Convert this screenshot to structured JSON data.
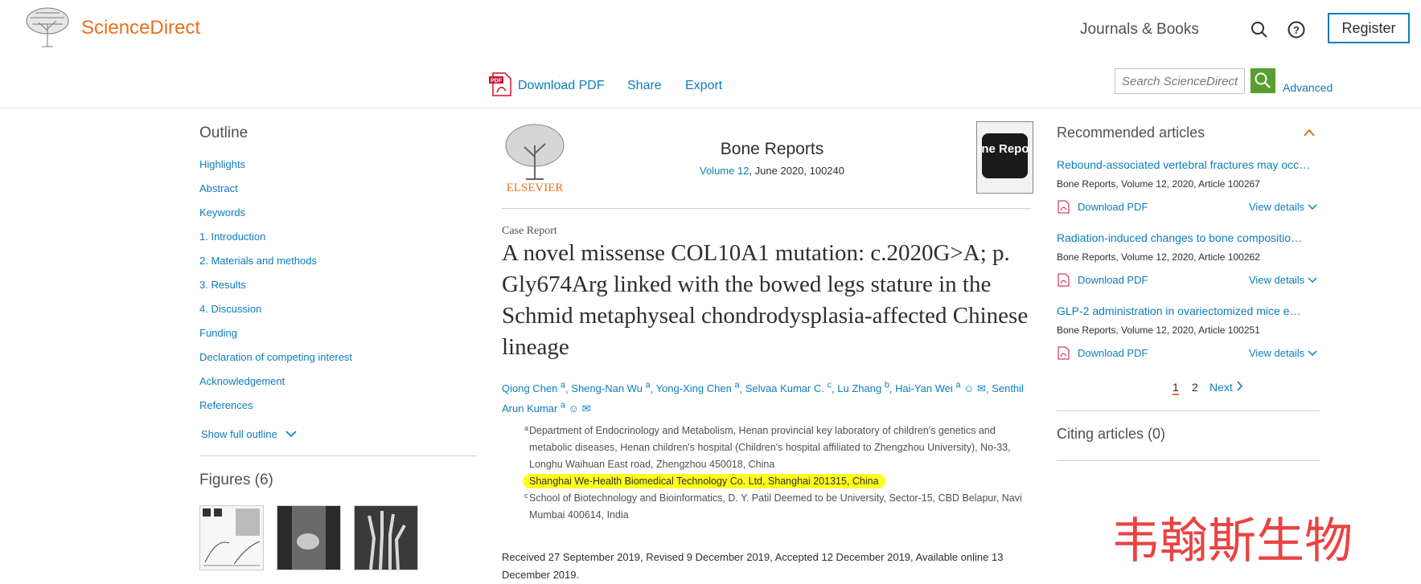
{
  "header": {
    "brand": "ScienceDirect",
    "journals_books": "Journals & Books",
    "register": "Register"
  },
  "toolbar": {
    "download_pdf": "Download PDF",
    "share": "Share",
    "export": "Export",
    "search_placeholder": "Search ScienceDirect",
    "advanced": "Advanced"
  },
  "outline": {
    "title": "Outline",
    "items": [
      "Highlights",
      "Abstract",
      "Keywords",
      "1. Introduction",
      "2. Materials and methods",
      "3. Results",
      "4. Discussion",
      "Funding",
      "Declaration of competing interest",
      "Acknowledgement",
      "References"
    ],
    "show_full": "Show full outline",
    "figures_title": "Figures (6)"
  },
  "article": {
    "publisher": "ELSEVIER",
    "journal": "Bone Reports",
    "volume_link": "Volume 12",
    "issue_info": ", June 2020, 100240",
    "cover_text": "Bone Reports",
    "type": "Case Report",
    "title": "A novel missense COL10A1 mutation: c.2020G>A; p. Gly674Arg linked with the bowed legs stature in the Schmid metaphyseal chondrodysplasia-affected Chinese lineage",
    "authors": [
      {
        "name": "Qiong Chen",
        "sup": "a"
      },
      {
        "name": "Sheng-Nan Wu",
        "sup": "a"
      },
      {
        "name": "Yong-Xing Chen",
        "sup": "a"
      },
      {
        "name": "Selvaa Kumar C.",
        "sup": "c"
      },
      {
        "name": "Lu Zhang",
        "sup": "b"
      },
      {
        "name": "Hai-Yan Wei",
        "sup": "a"
      },
      {
        "name": "Senthil Arun Kumar",
        "sup": "a"
      }
    ],
    "affiliations": [
      {
        "label": "a",
        "text": "Department of Endocrinology and Metabolism, Henan provincial key laboratory of children's genetics and metabolic diseases, Henan children's hospital (Children's hospital affiliated to Zhengzhou University), No-33, Longhu Waihuan East road, Zhengzhou 450018, China"
      },
      {
        "label": "b",
        "text": "Shanghai We-Health Biomedical Technology Co. Ltd, Shanghai 201315, China"
      },
      {
        "label": "c",
        "text": "School of Biotechnology and Bioinformatics, D. Y. Patil Deemed to be University, Sector-15, CBD Belapur, Navi Mumbai 400614, India"
      }
    ],
    "history": "Received 27 September 2019, Revised 9 December 2019, Accepted 12 December 2019, Available online 13 December 2019."
  },
  "recommended": {
    "title": "Recommended articles",
    "items": [
      {
        "title": "Rebound-associated vertebral fractures may occ…",
        "meta": "Bone Reports, Volume 12, 2020, Article 100267",
        "pdf": "Download PDF",
        "view": "View details"
      },
      {
        "title": "Radiation-induced changes to bone compositio…",
        "meta": "Bone Reports, Volume 12, 2020, Article 100262",
        "pdf": "Download PDF",
        "view": "View details"
      },
      {
        "title": "GLP-2 administration in ovariectomized mice e…",
        "meta": "Bone Reports, Volume 12, 2020, Article 100251",
        "pdf": "Download PDF",
        "view": "View details"
      }
    ],
    "pages": [
      "1",
      "2"
    ],
    "next": "Next"
  },
  "citing": "Citing articles (0)",
  "watermark": "韦翰斯生物"
}
